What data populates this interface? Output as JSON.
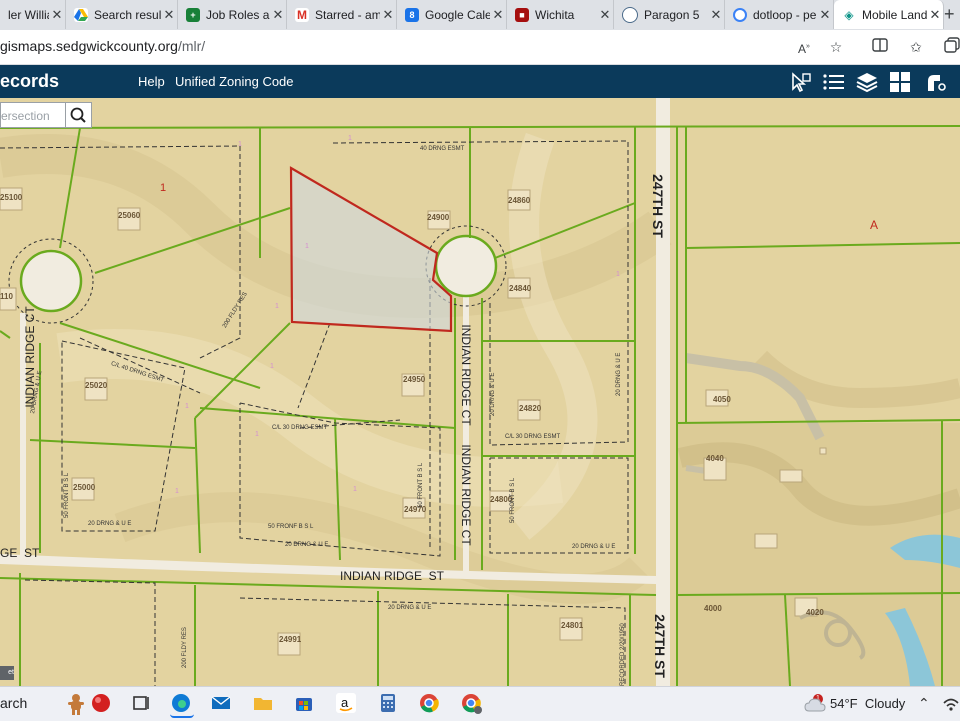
{
  "tabs": [
    {
      "title": "ler Willian",
      "icon": "generic-icon",
      "color": "#5f6368"
    },
    {
      "title": "Search resul",
      "icon": "google-drive-icon",
      "color": "#1a73e8"
    },
    {
      "title": "Job Roles an",
      "icon": "google-sheets-icon",
      "color": "#188038"
    },
    {
      "title": "Starred - am",
      "icon": "gmail-icon",
      "color": "#d93025"
    },
    {
      "title": "Google Cale",
      "icon": "google-calendar-icon",
      "color": "#1a73e8"
    },
    {
      "title": "Wichita",
      "icon": "wichita-icon",
      "color": "#a50e0e"
    },
    {
      "title": "Paragon 5",
      "icon": "paragon-icon",
      "color": "#4a6a8a"
    },
    {
      "title": "dotloop - pe",
      "icon": "dotloop-icon",
      "color": "#3b82f6"
    },
    {
      "title": "Mobile Land",
      "icon": "mobile-land-icon",
      "color": "#0d9488"
    }
  ],
  "address": {
    "host": "gismaps.sedgwickcounty.org",
    "path": "/mlr/"
  },
  "app": {
    "title": "ecords",
    "nav": [
      "Help",
      "Unified Zoning Code"
    ],
    "search_placeholder": "ersection"
  },
  "map": {
    "street_labels": [
      "247TH ST",
      "247TH ST",
      "INDIAN RIDGE CT",
      "INDIAN RIDGE CT",
      "INDIAN RIDGE CT",
      "INDIAN RIDGE  ST",
      "GE  ST"
    ],
    "parcel_labels": [
      "25100",
      "25060",
      "24900",
      "24860",
      "24840",
      "25020",
      "24950",
      "24820",
      "25000",
      "24800",
      "24970",
      "24991",
      "24801",
      "4050",
      "4040",
      "4000",
      "4020",
      "110"
    ],
    "block_labels": [
      "1",
      "A"
    ],
    "easement_labels": [
      "40 DRNG ESMT",
      "200 FLDY RES",
      "C/L 40 DRNG ESMT",
      "C/L 30 DRNG ESMT",
      "C/L 30 DRNG ESMT",
      "20 DRNG & U E",
      "20 DRNG & U E",
      "20 DRNG & U E",
      "50 FRONT B S L",
      "50 FRONT B S L",
      "50 FRONT B S L",
      "20 DRNG & U E",
      "20 DRNG & U E",
      "20 DRNG & U E",
      "50 FRONF B S L",
      "20 DRNG & U E",
      "200 FLDY RES",
      "RECORDED 2/20/1950"
    ],
    "selected_parcel_color": "#c0281e",
    "parcel_line_color": "#6aaa1e",
    "attribution": "et"
  },
  "taskbar": {
    "search": "arch",
    "weather_temp": "54°F",
    "weather_cond": "Cloudy",
    "badge": "1"
  }
}
